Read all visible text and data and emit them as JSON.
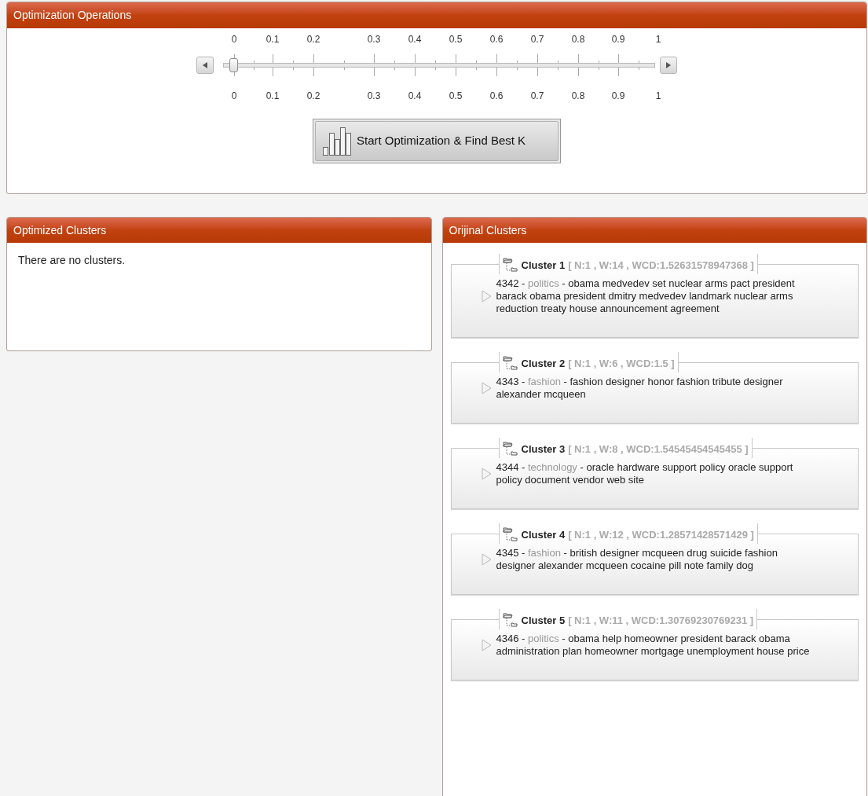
{
  "optimization_panel": {
    "title": "Optimization Operations",
    "slider": {
      "level": 0,
      "top_labels": [
        "0",
        "0.1",
        "0.2",
        "0.3",
        "0.4",
        "0.5",
        "0.6",
        "0.7",
        "0.8",
        "0.9",
        "1"
      ],
      "bottom_labels": [
        "0",
        "0.1",
        "0.2",
        "0.3",
        "0.4",
        "0.5",
        "0.6",
        "0.7",
        "0.8",
        "0.9",
        "1"
      ]
    },
    "button": "Start Optimization & Find Best K"
  },
  "optimized_clusters": {
    "title": "Optimized Clusters",
    "message": "There are no clusters."
  },
  "original_clusters": {
    "title": "Orijinal Clusters",
    "clusters": [
      {
        "name": "Cluster 1",
        "stats": "[ N:1 , W:14 , WCD:1.52631578947368 ]",
        "documents": [
          {
            "id": "4342 -",
            "category": "politics",
            "text": "- obama medvedev set nuclear arms pact president barack obama president dmitry medvedev landmark nuclear arms reduction treaty house announcement agreement"
          }
        ]
      },
      {
        "name": "Cluster 2",
        "stats": "[ N:1 , W:6 , WCD:1.5 ]",
        "documents": [
          {
            "id": "4343 -",
            "category": "fashion",
            "text": "- fashion designer honor fashion tribute designer alexander mcqueen"
          }
        ]
      },
      {
        "name": "Cluster 3",
        "stats": "[ N:1 , W:8 , WCD:1.54545454545455 ]",
        "documents": [
          {
            "id": "4344 -",
            "category": "technology",
            "text": "- oracle hardware support policy oracle support policy document vendor web site"
          }
        ]
      },
      {
        "name": "Cluster 4",
        "stats": "[ N:1 , W:12 , WCD:1.28571428571429 ]",
        "documents": [
          {
            "id": "4345 -",
            "category": "fashion",
            "text": "- british designer mcqueen drug suicide fashion designer alexander mcqueen cocaine pill note family dog"
          }
        ]
      },
      {
        "name": "Cluster 5",
        "stats": "[ N:1 , W:11 , WCD:1.30769230769231 ]",
        "documents": [
          {
            "id": "4346 -",
            "category": "politics",
            "text": "- obama help homeowner president barack obama administration plan homeowner mortgage unemployment house price"
          }
        ]
      }
    ]
  }
}
